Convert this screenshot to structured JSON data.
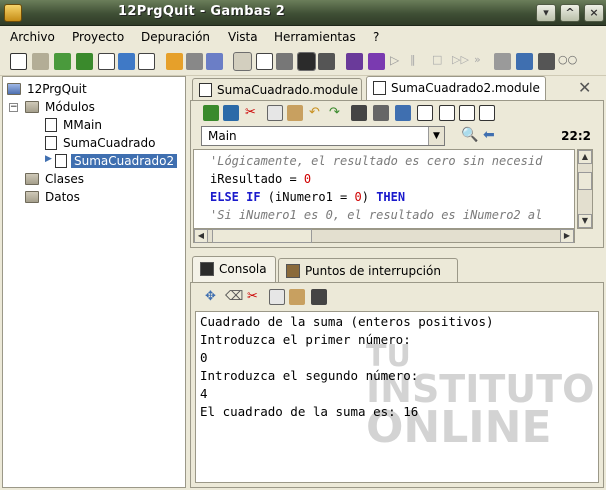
{
  "window": {
    "title": "12PrgQuit - Gambas 2"
  },
  "menu": [
    "Archivo",
    "Proyecto",
    "Depuración",
    "Vista",
    "Herramientas",
    "?"
  ],
  "tree": {
    "root": "12PrgQuit",
    "folders": [
      "Módulos",
      "Clases",
      "Datos"
    ],
    "modules": [
      "MMain",
      "SumaCuadrado",
      "SumaCuadrado2"
    ]
  },
  "editor_tabs": [
    "SumaCuadrado.module",
    "SumaCuadrado2.module"
  ],
  "editor": {
    "procedure": "Main",
    "position": "22:2",
    "lines": [
      {
        "text": "'Lógicamente, el resultado es cero sin necesid"
      },
      {
        "a": "iResultado = ",
        "b": "0"
      },
      {
        "k1": "ELSE IF",
        "t1": " (iNumero1 = ",
        "n1": "0",
        "t2": ") ",
        "k2": "THEN"
      },
      {
        "text": "'Si iNumero1 es 0, el resultado es iNumero2 al"
      }
    ]
  },
  "bottom_tabs": [
    "Consola",
    "Puntos de interrupción"
  ],
  "console": {
    "lines": [
      "Cuadrado de la suma (enteros positivos)",
      "Introduzca el primer número:",
      "0",
      "Introduzca el segundo número:",
      "4",
      "El cuadrado de la suma es: 16"
    ]
  },
  "watermark": {
    "line1": "TU",
    "line2": "INSTITUTO",
    "line3": "ONLINE"
  }
}
